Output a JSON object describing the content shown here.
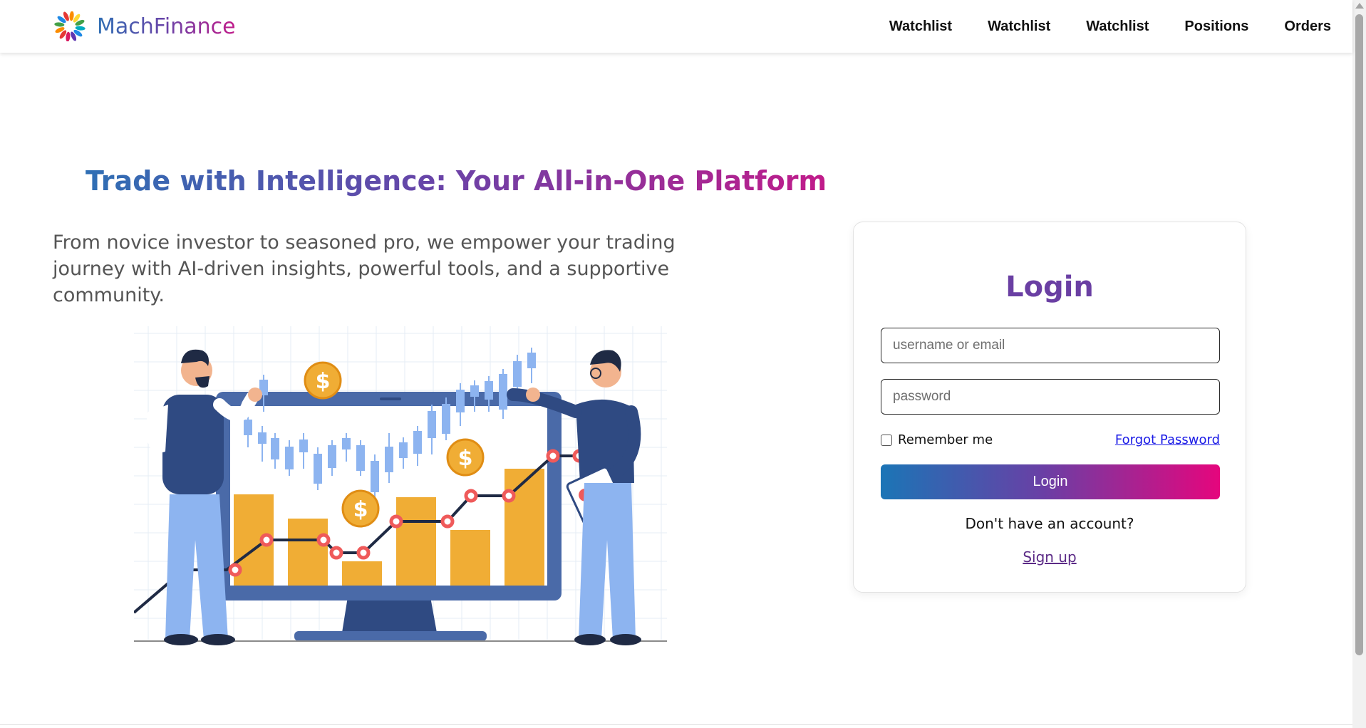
{
  "brand": {
    "name": "MachFinance",
    "logo": "rainbow-ring-logo-icon"
  },
  "nav": {
    "items": [
      {
        "label": "Watchlist"
      },
      {
        "label": "Watchlist"
      },
      {
        "label": "Watchlist"
      },
      {
        "label": "Positions"
      },
      {
        "label": "Orders"
      }
    ]
  },
  "hero": {
    "title": "Trade with Intelligence: Your All-in-One Platform",
    "subtitle": "From novice investor to seasoned pro, we empower your trading journey with AI-driven insights, powerful tools, and a supportive community.",
    "illustration": "trading-chart-illustration"
  },
  "login": {
    "title": "Login",
    "username_placeholder": "username or email",
    "password_placeholder": "password",
    "remember_label": "Remember me",
    "remember_checked": false,
    "forgot_label": "Forgot Password",
    "button_label": "Login",
    "no_account_text": "Don't have an account?",
    "signup_label": "Sign up"
  },
  "colors": {
    "brand_blue": "#2f6fb4",
    "brand_purple": "#6a3fa3",
    "brand_pink": "#e5067d",
    "chart_bar": "#f0ad35",
    "chart_candle": "#8db4f0",
    "monitor": "#4a6aa8"
  }
}
